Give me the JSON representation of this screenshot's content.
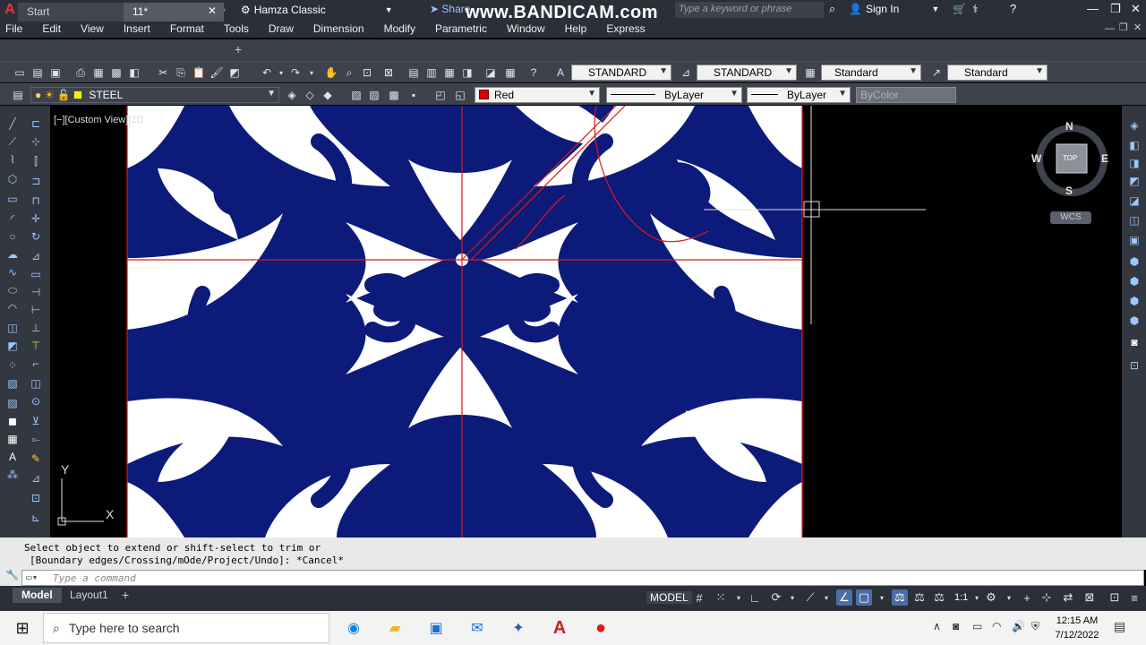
{
  "titlebar": {
    "workspace": "Hamza Classic",
    "share": "Share",
    "watermark": "www.BANDICAM.com",
    "search_placeholder": "Type a keyword or phrase",
    "signin": "Sign In"
  },
  "menu": [
    "File",
    "Edit",
    "View",
    "Insert",
    "Format",
    "Tools",
    "Draw",
    "Dimension",
    "Modify",
    "Parametric",
    "Window",
    "Help",
    "Express"
  ],
  "tabs": {
    "start": "Start",
    "doc": "11*"
  },
  "toolbar1": {
    "text_style": "STANDARD",
    "dim_style": "STANDARD",
    "table_style": "Standard",
    "mleader_style": "Standard"
  },
  "toolbar2": {
    "layer": "STEEL",
    "color": "Red",
    "linetype": "ByLayer",
    "lineweight": "ByLayer",
    "plotstyle": "ByColor"
  },
  "viewport": {
    "label": "[−][Custom View][2D"
  },
  "viewcube": {
    "north": "N",
    "south": "S",
    "east": "E",
    "west": "W",
    "face": "TOP",
    "wcs": "WCS"
  },
  "ucs": {
    "y": "Y",
    "x": "X"
  },
  "command": {
    "line1": "Select object to extend or shift-select to trim or",
    "line2": "[Boundary edges/Crossing/mOde/Project/Undo]: *Cancel*",
    "placeholder": "Type a command"
  },
  "layout_tabs": {
    "model": "Model",
    "layout1": "Layout1"
  },
  "status": {
    "model": "MODEL",
    "scale": "1:1"
  },
  "taskbar": {
    "search": "Type here to search",
    "time": "12:15 AM",
    "date": "7/12/2022"
  },
  "colors": {
    "pattern_blue": "#0c1a7a",
    "pattern_white": "#ffffff",
    "line_red": "#e01818",
    "ui_dark": "#2b2f38"
  }
}
